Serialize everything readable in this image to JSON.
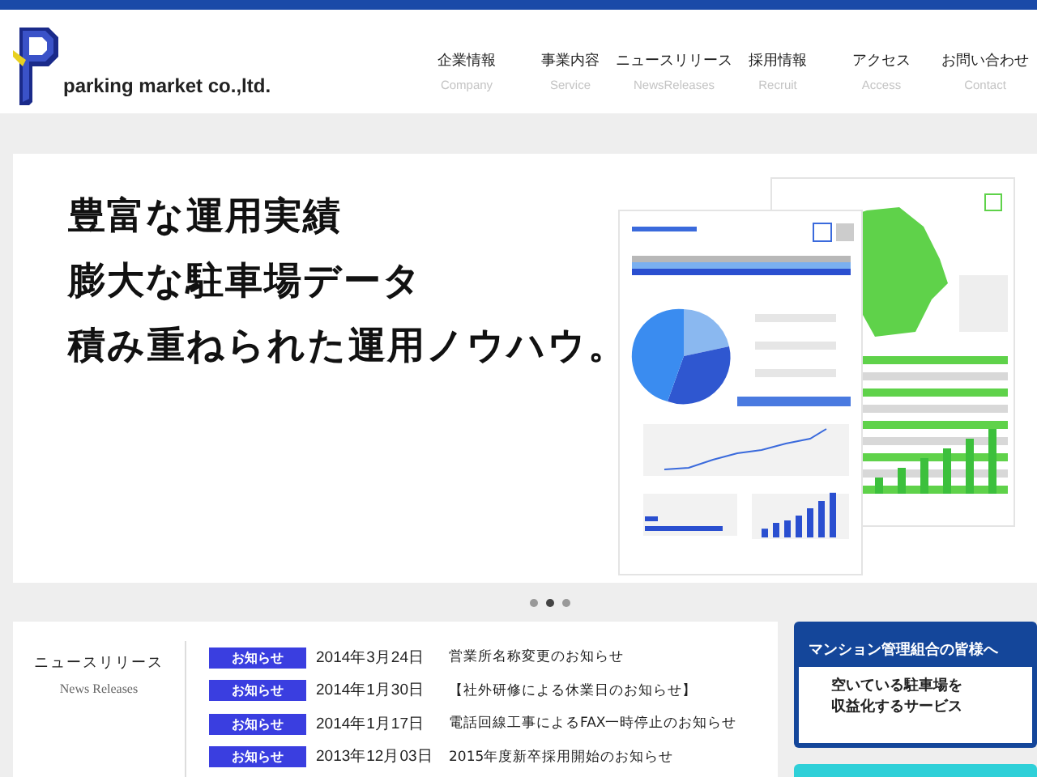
{
  "header": {
    "logo": "parking market co.,ltd.",
    "nav": [
      {
        "label": "企業情報",
        "sub": "Company"
      },
      {
        "label": "事業内容",
        "sub": "Service"
      },
      {
        "label": "ニュースリリース",
        "sub": "NewsReleases"
      },
      {
        "label": "採用情報",
        "sub": "Recruit"
      },
      {
        "label": "アクセス",
        "sub": "Access"
      },
      {
        "label": "お問い合わせ",
        "sub": "Contact"
      }
    ]
  },
  "hero": {
    "lines": [
      "豊富な運用実績",
      "膨大な駐車場データ",
      "積み重ねられた運用ノウハウ。"
    ]
  },
  "carousel": [
    {
      "selected": false
    },
    {
      "selected": true
    },
    {
      "selected": false
    }
  ],
  "news": {
    "title": "ニュースリリース",
    "subtitle": "News Releases",
    "items": [
      {
        "badge": "お知らせ",
        "date": "2014年3月24日",
        "text": "営業所名称変更のお知らせ"
      },
      {
        "badge": "お知らせ",
        "date": "2014年1月30日",
        "text": "【社外研修による休業日のお知らせ】"
      },
      {
        "badge": "お知らせ",
        "date": "2014年1月17日",
        "text": "電話回線工事によるFAX一時停止のお知らせ"
      },
      {
        "badge": "お知らせ",
        "date": "2013年12月03日",
        "text": "2015年度新卒採用開始のお知らせ"
      }
    ]
  },
  "banner": {
    "title": "マンション管理組合の皆様へ",
    "lines": [
      "空いている駐車場を",
      "収益化するサービス"
    ]
  }
}
